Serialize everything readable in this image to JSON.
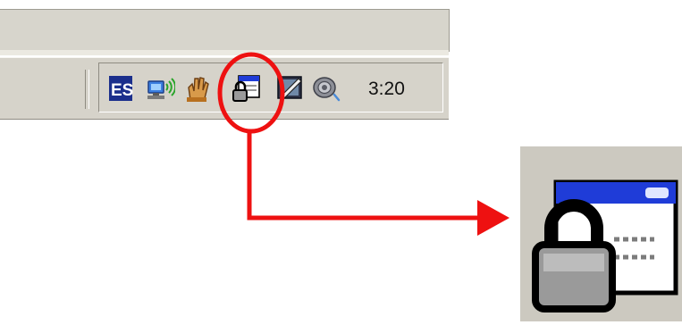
{
  "taskbar": {
    "clock_time": "3:20",
    "tray_icons": [
      {
        "name": "es-app-icon",
        "label": "ES"
      },
      {
        "name": "network-wireless-icon"
      },
      {
        "name": "hand-sharing-icon"
      },
      {
        "name": "lock-window-icon"
      },
      {
        "name": "display-pen-icon"
      },
      {
        "name": "speaker-volume-icon"
      }
    ]
  },
  "annotation": {
    "color": "#ee1111",
    "highlighted_icon": "lock-window-icon"
  },
  "colors": {
    "taskbar_bg": "#d6d3ca",
    "accent_blue": "#1f3cd8"
  }
}
